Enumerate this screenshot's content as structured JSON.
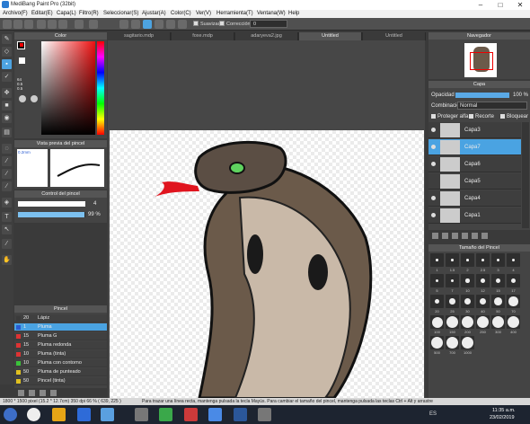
{
  "window": {
    "title": "MediBang Paint Pro (32bit)"
  },
  "menu": [
    "Archivo(F)",
    "Editar(E)",
    "Capa(L)",
    "Filtro(R)",
    "Seleccionar(S)",
    "Ajustar(A)",
    "Color(C)",
    "Ver(V)",
    "Herramienta(T)",
    "Ventana(W)",
    "Help"
  ],
  "toolbar": {
    "smooth_label": "Suavizado",
    "correction_label": "Corrección",
    "correction_value": "0"
  },
  "color_panel": {
    "title": "Color",
    "r": "64",
    "g": "0.5",
    "b": "0.5"
  },
  "brush_preview": {
    "title": "Vista previa del pincel",
    "size_label": "0.2mm"
  },
  "brush_control": {
    "title": "Control del pincel",
    "size_value": "4",
    "opacity_value": "99 %",
    "opacity_fraction": 0.99
  },
  "brush_panel": {
    "title": "Pincel",
    "items": [
      {
        "size": "20",
        "name": "Lápiz",
        "color": "#3a3a3a"
      },
      {
        "size": "1",
        "name": "Pluma",
        "color": "#2a5bd1",
        "selected": true
      },
      {
        "size": "15",
        "name": "Pluma G",
        "color": "#d33"
      },
      {
        "size": "15",
        "name": "Pluma redonda",
        "color": "#d33"
      },
      {
        "size": "10",
        "name": "Pluma (tinta)",
        "color": "#d33"
      },
      {
        "size": "10",
        "name": "Pluma con contorno",
        "color": "#3ac23a"
      },
      {
        "size": "50",
        "name": "Pluma de punteado",
        "color": "#e0c020"
      },
      {
        "size": "50",
        "name": "Pincel (tinta)",
        "color": "#e0c020"
      }
    ]
  },
  "tabs": [
    {
      "label": "sagitario.mdp",
      "active": false
    },
    {
      "label": "foxe.mdp",
      "active": false
    },
    {
      "label": "adaryeva2.jpg",
      "active": false
    },
    {
      "label": "Untitled",
      "active": true
    },
    {
      "label": "Untitled",
      "active": false
    }
  ],
  "navigator": {
    "title": "Navegador"
  },
  "layer_panel": {
    "title": "Capa",
    "opacity_label": "Opacidad",
    "opacity_value": "100 %",
    "blend_label": "Combinación",
    "blend_value": "Normal",
    "protect_label": "Proteger alfa",
    "clip_label": "Recorte",
    "lock_label": "Bloquear",
    "layers": [
      {
        "name": "Capa3",
        "visible": true,
        "selected": false
      },
      {
        "name": "Capa7",
        "visible": true,
        "selected": true
      },
      {
        "name": "Capa6",
        "visible": true,
        "selected": false
      },
      {
        "name": "Capa5",
        "visible": false,
        "selected": false
      },
      {
        "name": "Capa4",
        "visible": true,
        "selected": false
      },
      {
        "name": "Capa1",
        "visible": true,
        "selected": false
      }
    ]
  },
  "brush_size_panel": {
    "title": "Tamaño del Pincel",
    "sizes": [
      "1",
      "1.5",
      "2",
      "2.5",
      "3",
      "4",
      "5",
      "7",
      "10",
      "12",
      "15",
      "17",
      "20",
      "25",
      "30",
      "40",
      "50",
      "70",
      "100",
      "150",
      "200",
      "250",
      "300",
      "400",
      "500",
      "700",
      "1000"
    ]
  },
  "status": {
    "size": "1800 * 1500 pixel   (15.2 * 12.7cm)   350 dpi   66 %   ( 639, 225 )",
    "hint": "Para trazar una línea recta, mantenga pulsada la tecla Mayús. Para cambiar el tamaño del pincel, mantenga pulsada las teclas Ctrl + Alt y arrastre"
  },
  "taskbar": {
    "lang": "ES",
    "time": "11:35 a.m.",
    "date": "23/02/2019"
  }
}
